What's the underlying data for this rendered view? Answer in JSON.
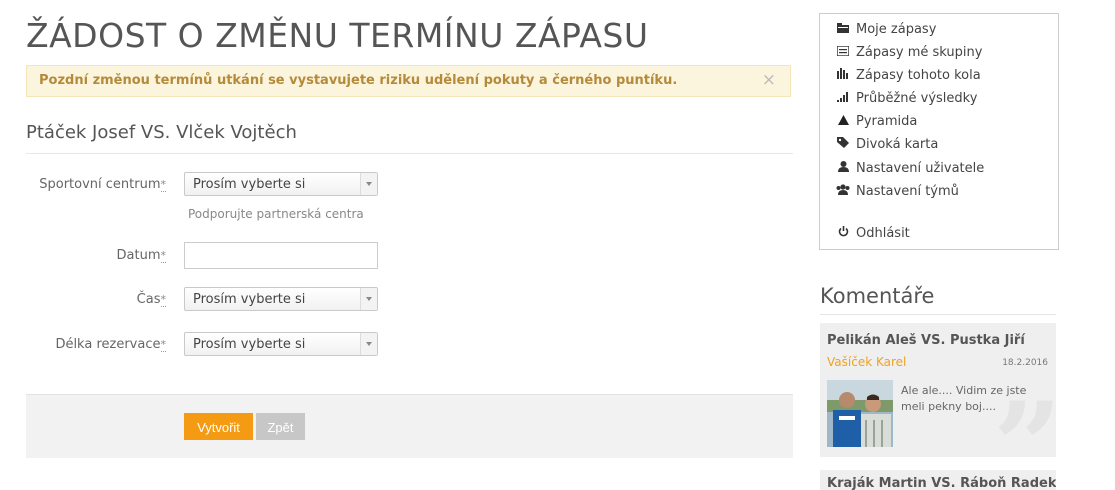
{
  "page": {
    "title": "ŽÁDOST O ZMĚNU TERMÍNU ZÁPASU",
    "alert": "Pozdní změnou termínů utkání se vystavujete riziku udělení pokuty a černého puntíku.",
    "alert_close": "×",
    "match": "Ptáček Josef VS. Vlček Vojtěch"
  },
  "form": {
    "sport_center": {
      "label": "Sportovní centrum",
      "required": "*",
      "value": "Prosím vyberte si",
      "help": "Podporujte partnerská centra"
    },
    "date": {
      "label": "Datum",
      "required": "*",
      "value": ""
    },
    "time": {
      "label": "Čas",
      "required": "*",
      "value": "Prosím vyberte si"
    },
    "duration": {
      "label": "Délka rezervace",
      "required": "*",
      "value": "Prosím vyberte si"
    },
    "submit_label": "Vytvořit",
    "back_label": "Zpět"
  },
  "sidebar": {
    "items": [
      {
        "label": "Moje zápasy",
        "icon": "folder-icon"
      },
      {
        "label": "Zápasy mé skupiny",
        "icon": "list-icon"
      },
      {
        "label": "Zápasy tohoto kola",
        "icon": "bar-chart-icon"
      },
      {
        "label": "Průběžné výsledky",
        "icon": "signal-icon"
      },
      {
        "label": "Pyramida",
        "icon": "triangle-icon"
      },
      {
        "label": "Divoká karta",
        "icon": "tags-icon"
      },
      {
        "label": "Nastavení uživatele",
        "icon": "user-icon"
      },
      {
        "label": "Nastavení týmů",
        "icon": "users-icon"
      },
      {
        "label": "Odhlásit",
        "icon": "power-icon"
      }
    ]
  },
  "comments": {
    "title": "Komentáře",
    "items": [
      {
        "match": "Pelikán Aleš VS. Pustka Jiří",
        "author": "Vašíček Karel",
        "date": "18.2.2016",
        "text": "Ale ale.... Vidim ze jste meli pekny boj....",
        "quote": "”"
      },
      {
        "match": "Kraják Martin VS. Ráboň Radek"
      }
    ]
  }
}
